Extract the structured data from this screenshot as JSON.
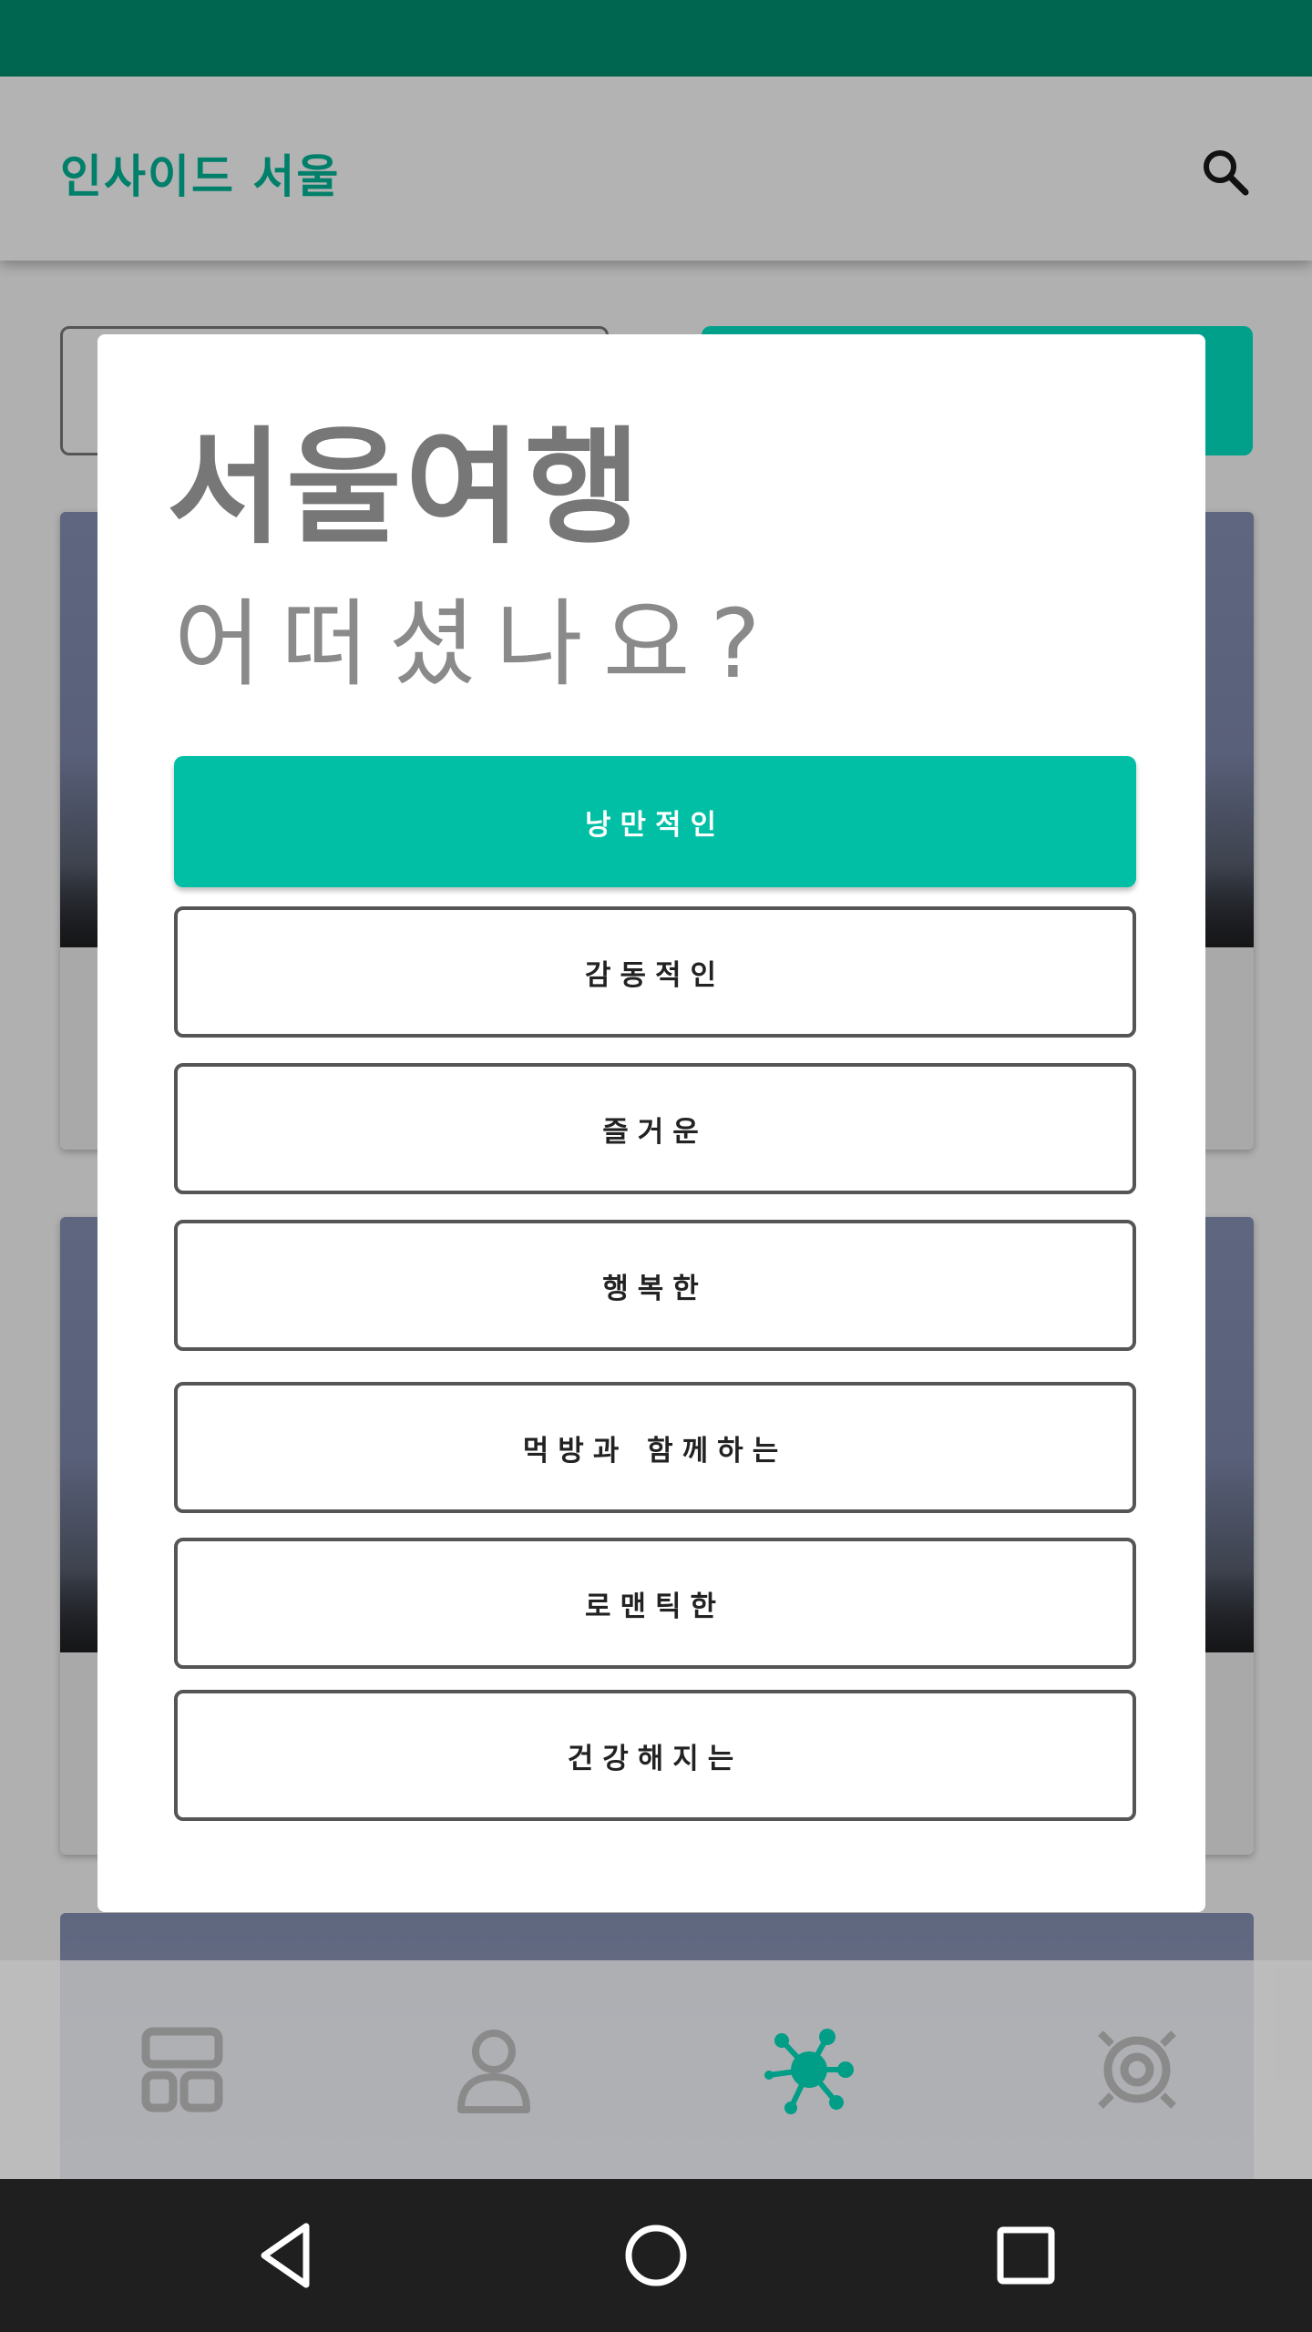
{
  "app": {
    "title": "인사이드 서울"
  },
  "dialog": {
    "title": "서울여행",
    "subtitle": "어떠셨나요?",
    "options": [
      {
        "label": "낭만적인",
        "selected": true
      },
      {
        "label": "감동적인",
        "selected": false
      },
      {
        "label": "즐거운",
        "selected": false
      },
      {
        "label": "행복한",
        "selected": false
      },
      {
        "label": "먹방과 함께하는",
        "selected": false
      },
      {
        "label": "로맨틱한",
        "selected": false
      },
      {
        "label": "건강해지는",
        "selected": false
      }
    ]
  },
  "icons": {
    "search": "search-icon",
    "nav": [
      "dashboard-icon",
      "person-icon",
      "molecule-icon",
      "target-icon"
    ],
    "system": [
      "back-icon",
      "home-icon",
      "recents-icon"
    ]
  },
  "colors": {
    "accent": "#00bfa5",
    "status_bar": "#00664f",
    "title_accent": "#00806a",
    "scrim": "#b3b3b3"
  }
}
